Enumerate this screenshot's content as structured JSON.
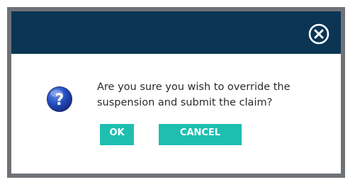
{
  "dialog": {
    "message": "Are you sure you wish to override the suspension and submit the claim?",
    "ok_label": "OK",
    "cancel_label": "CANCEL",
    "close_icon": "close-circle-icon",
    "question_icon": "question-icon"
  },
  "colors": {
    "titlebar": "#0b3553",
    "frame": "#6e7277",
    "button": "#1fbfb0",
    "button_text": "#ffffff",
    "icon_blue": "#1f4fb8"
  }
}
